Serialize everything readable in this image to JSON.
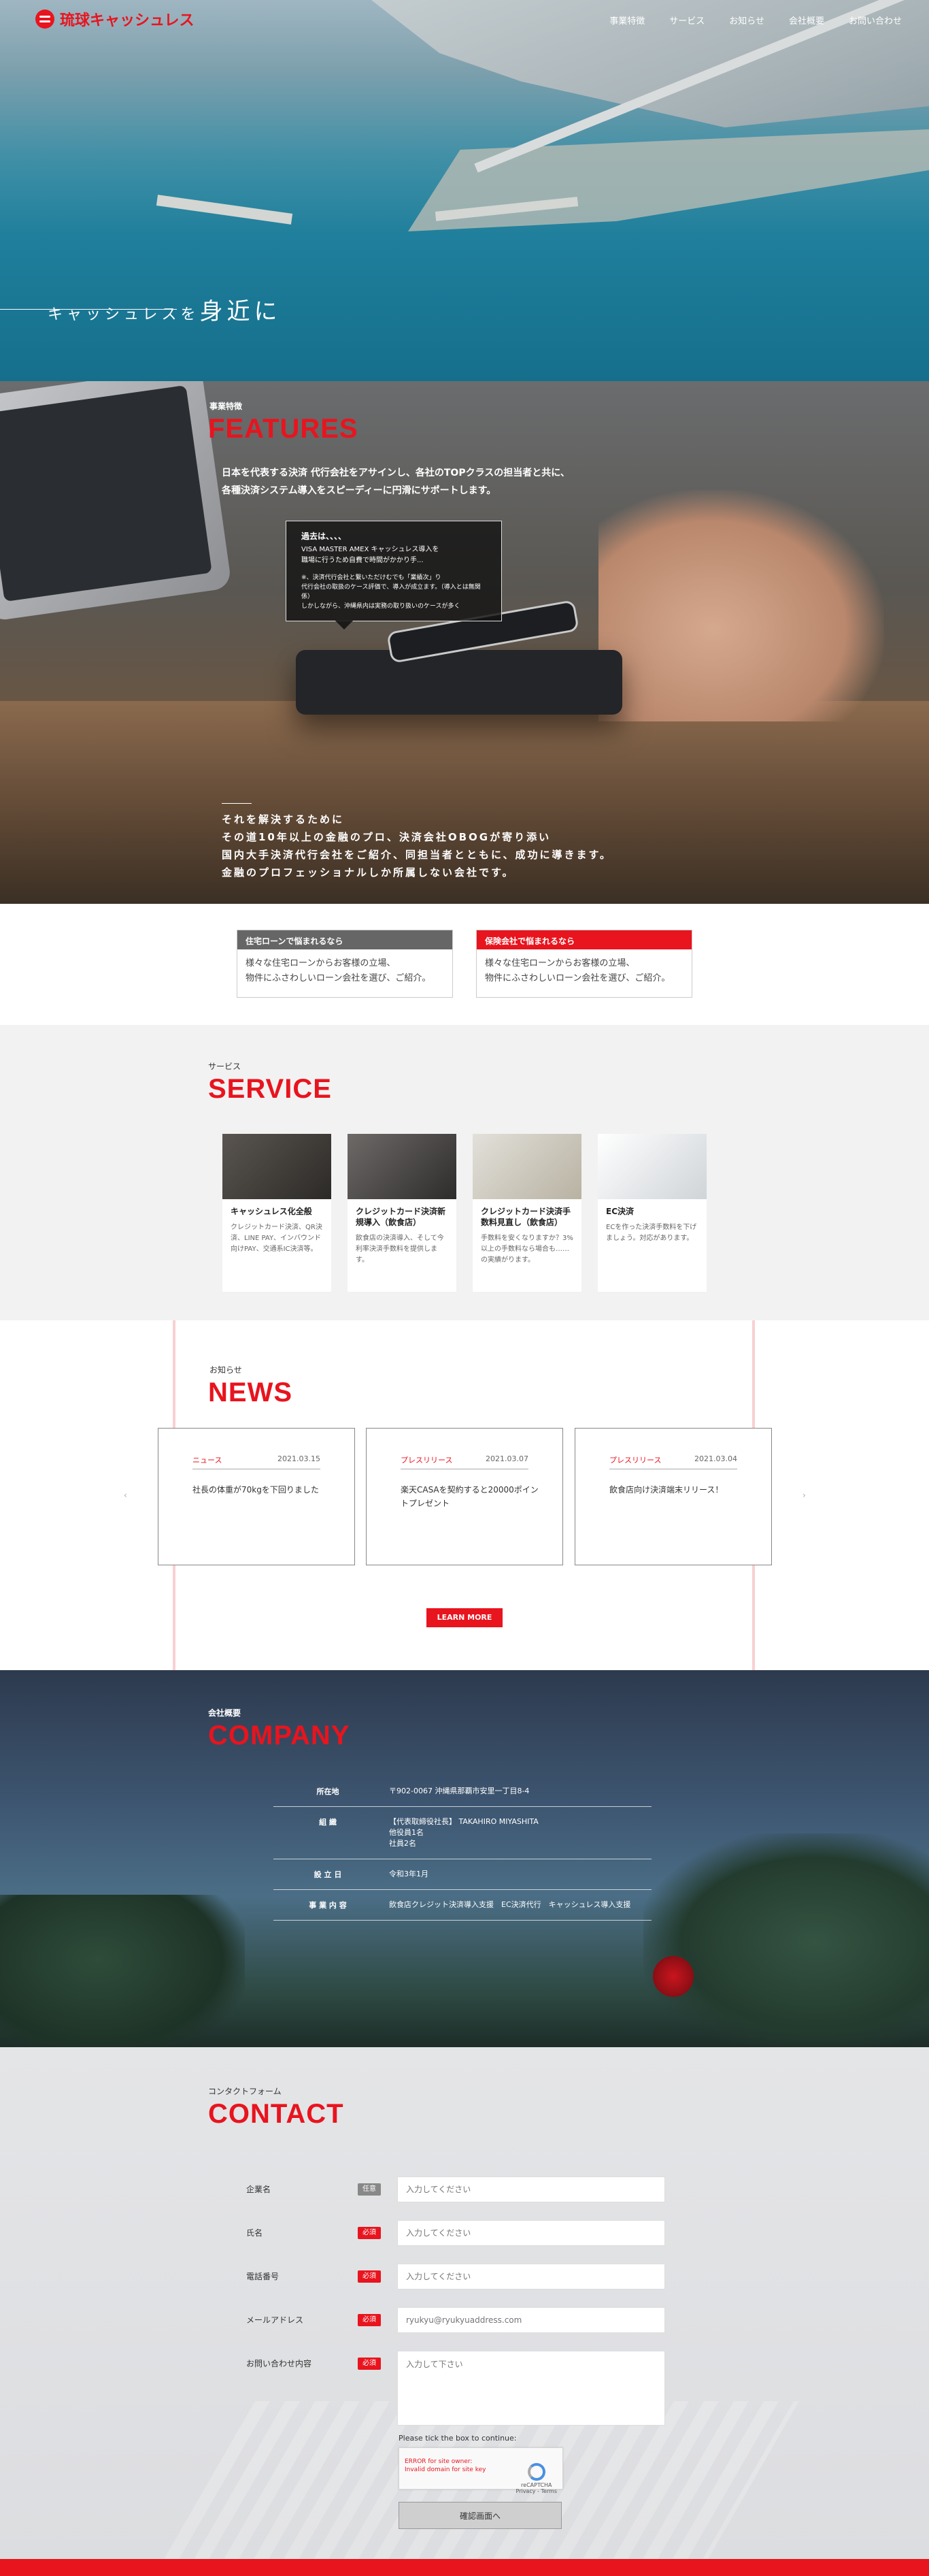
{
  "header": {
    "brand": "琉球キャッシュレス",
    "nav": [
      "事業特徴",
      "サービス",
      "お知らせ",
      "会社概要",
      "お問い合わせ"
    ]
  },
  "hero": {
    "tagline_a": "キャッシュレスを",
    "tagline_b": "身近に"
  },
  "features": {
    "sub": "事業特徴",
    "title": "FEATURES",
    "lead": [
      "日本を代表する決済 代行会社をアサインし、各社のTOPクラスの担当者と共に、",
      "各種決済システム導入をスピーディーに円滑にサポートします。"
    ],
    "bubble_title": "過去は、、、、",
    "bubble_lines": [
      "VISA MASTER AMEX キャッシュレス導入を",
      "職場に行うため自費で時間がかかり手...",
      "※、決済代行会社と繋いただけむでも「業績次」り",
      "代行会社の取扱のケース評価で、導入が成立ます。（導入とは無関係）",
      "しかしながら、沖縄県内は実務の取り扱いのケースが多く"
    ],
    "closing": [
      "それを解決するために",
      "その道10年以上の金融のプロ、決済会社OBOGが寄り添い",
      "国内大手決済代行会社をご紹介、同担当者とともに、成功に導きます。",
      "金融のプロフェッショナルしか所属しない会社です。"
    ]
  },
  "loan": [
    {
      "head": "住宅ローンで悩まれるなら",
      "body": [
        "様々な住宅ローンからお客様の立場、",
        "物件にふさわしいローン会社を選び、ご紹介。"
      ]
    },
    {
      "head": "保険会社で悩まれるなら",
      "body": [
        "様々な住宅ローンからお客様の立場、",
        "物件にふさわしいローン会社を選び、ご紹介。"
      ]
    }
  ],
  "service": {
    "sub": "サービス",
    "title": "SERVICE",
    "cards": [
      {
        "title": "キャッシュレス化全般",
        "desc": "クレジットカード決済、QR決済、LINE PAY、インバウンド向けPAY、交通系IC決済等。"
      },
      {
        "title": "クレジットカード決済新規導入（飲食店）",
        "desc": "飲食店の決済導入、そして今利率決済手数料を提供します。"
      },
      {
        "title": "クレジットカード決済手数料見直し（飲食店）",
        "desc": "手数料を安くなりますか？3%以上の手数料なら場合も……の実績がります。"
      },
      {
        "title": "EC決済",
        "desc": "ECを作った決済手数料を下げましょう。対応があります。"
      }
    ]
  },
  "news": {
    "sub": "お知らせ",
    "title": "NEWS",
    "items": [
      {
        "cat": "ニュース",
        "date": "2021.03.15",
        "title": "社長の体重が70kgを下回りました"
      },
      {
        "cat": "プレスリリース",
        "date": "2021.03.07",
        "title": "楽天CASAを契約すると20000ポイントプレゼント"
      },
      {
        "cat": "プレスリリース",
        "date": "2021.03.04",
        "title": "飲食店向け決済端末リリース！"
      }
    ],
    "prev": "‹",
    "next": "›",
    "more": "LEARN MORE"
  },
  "company": {
    "sub": "会社概要",
    "title": "COMPANY",
    "rows": [
      {
        "k": "所在地",
        "v": "〒902-0067 沖縄県那覇市安里一丁目8-4"
      },
      {
        "k": "組 織",
        "v": "【代表取締役社長】 TAKAHIRO MIYASHITA\n他役員1名\n社員2名"
      },
      {
        "k": "設 立 日",
        "v": "令和3年1月"
      },
      {
        "k": "事 業 内 容",
        "v": "飲食店クレジット決済導入支援　EC決済代行　キャッシュレス導入支援"
      }
    ]
  },
  "contact": {
    "sub": "コンタクトフォーム",
    "title": "CONTACT",
    "fields": [
      {
        "label": "企業名",
        "req": "任意",
        "placeholder": "入力してください"
      },
      {
        "label": "氏名",
        "req": "必須",
        "placeholder": "入力してください"
      },
      {
        "label": "電話番号",
        "req": "必須",
        "placeholder": "入力してください"
      },
      {
        "label": "メールアドレス",
        "req": "必須",
        "placeholder": "ryukyu@ryukyuaddress.com"
      },
      {
        "label": "お問い合わせ内容",
        "req": "必須",
        "placeholder": "入力して下さい"
      }
    ],
    "captcha_note": "Please tick the box to continue:",
    "captcha_error": "ERROR for site owner:\nInvalid domain for site key",
    "captcha_brand": "reCAPTCHA\nPrivacy - Terms",
    "submit": "確認画面へ"
  },
  "colors": {
    "accent": "#e8141e"
  }
}
